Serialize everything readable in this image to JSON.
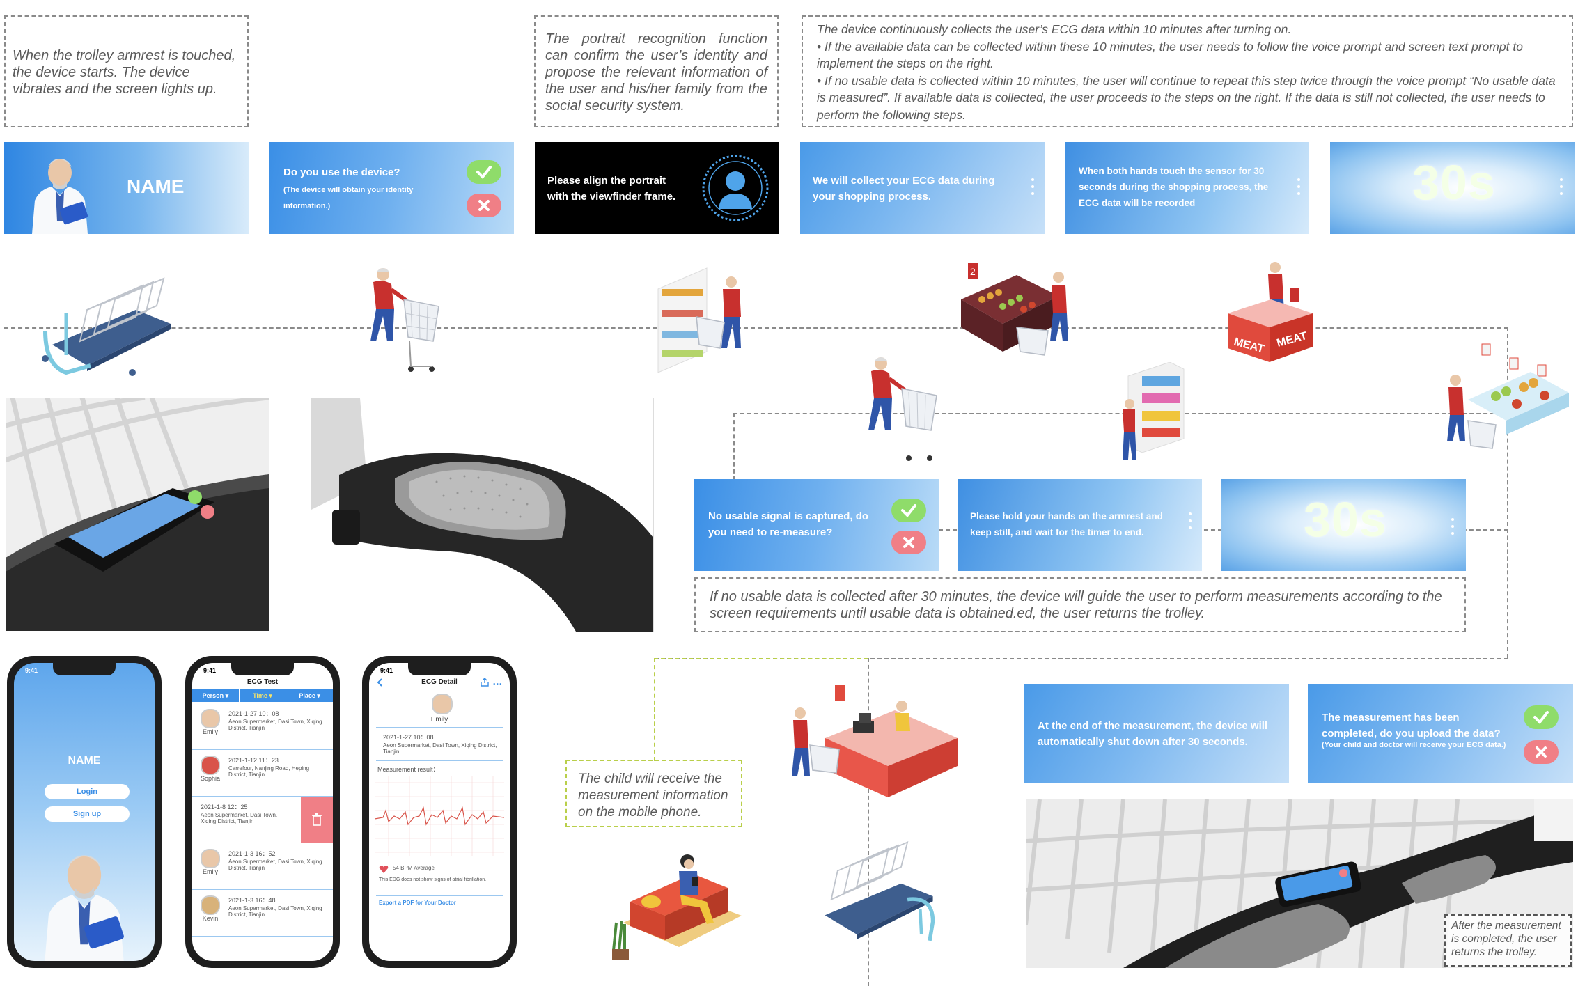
{
  "notes": {
    "start": "When the trolley armrest is touched, the device starts. The device vibrates and the screen lights up.",
    "portrait": "The portrait recognition function can confirm the user’s identity and propose the relevant information of the user and his/her family from the social security system.",
    "ecg_l1": "The device continuously collects the user’s ECG data within 10 minutes after turning on.",
    "ecg_l2": "• If the available data can be collected within these 10 minutes, the user needs to follow the voice prompt and screen text prompt to implement the steps on the right.",
    "ecg_l3": "• If no usable data is collected within 10 minutes, the user will continue to repeat this step twice through the voice prompt “No usable data is measured”. If available data is collected, the user proceeds to the steps on the right. If the data is still not collected, the user needs to perform the following steps.",
    "retry": "If no usable data is collected after 30 minutes, the device will guide the user to perform measurements according to the screen requirements until usable data is obtained.ed, the user returns the trolley.",
    "child": "The child will receive the measurement information on the mobile phone.",
    "return": "After the measurement is completed, the user returns the trolley."
  },
  "screens": {
    "name": "NAME",
    "use_q": "Do you use the device?",
    "use_sub": "(The device will obtain your identity information.)",
    "align": "Please align the portrait with the viewfinder frame.",
    "collect": "We will collect your ECG data during your shopping process.",
    "both_hands": "When both hands touch the sensor for 30 seconds during the shopping process, the ECG data will be recorded",
    "timer": "30s",
    "no_signal": "No usable signal is captured, do you need to re-measure?",
    "hold": "Please hold your hands on the armrest and keep still, and wait for the timer to end.",
    "timer2": "30s",
    "shutdown": "At the end of the measurement, the device will automatically shut down after 30 seconds.",
    "upload": "The measurement has been completed, do you upload the data?",
    "upload_sub": "(Your child and doctor will receive your ECG data.)"
  },
  "scene_labels": {
    "meat1": "MEAT",
    "meat2": "MEAT",
    "sign": "2"
  },
  "phones": {
    "p1": {
      "time": "9:41",
      "name": "NAME",
      "login": "Login",
      "signup": "Sign up"
    },
    "p2": {
      "time": "9:41",
      "title": "ECG Test",
      "filters": [
        "Person ▾",
        "Time ▾",
        "Place ▾"
      ],
      "rows": [
        {
          "name": "Emily",
          "date": "2021-1-27 10：08",
          "place": "Aeon Supermarket, Dasi Town, Xiqing District, Tianjin"
        },
        {
          "name": "Sophia",
          "date": "2021-1-12 11：23",
          "place": "Carrefour, Nanjing Road, Heping District, Tianjin"
        },
        {
          "name": "",
          "date": "2021-1-8 12：25",
          "place": "Aeon Supermarket, Dasi Town, Xiqing District, Tianjin"
        },
        {
          "name": "Emily",
          "date": "2021-1-3 16：52",
          "place": "Aeon Supermarket, Dasi Town, Xiqing District, Tianjin"
        },
        {
          "name": "Kevin",
          "date": "2021-1-3 16：48",
          "place": "Aeon Supermarket, Dasi Town, Xiqing District, Tianjin"
        }
      ]
    },
    "p3": {
      "time": "9:41",
      "title": "ECG Detail",
      "name": "Emily",
      "date": "2021-1-27 10：08",
      "place": "Aeon Supermarket, Dasi Town, Xiqing District, Tianjin",
      "result_label": "Measurement result：",
      "bpm": "54 BPM Average",
      "note": "This EDG does not show signs of atrial fibrillation.",
      "export": "Export a PDF for Your Doctor"
    }
  },
  "colors": {
    "accent": "#4a9ae8",
    "ok": "#8fdc6a",
    "cancel": "#f07f86",
    "dash": "#8a8a8a",
    "child_dash": "#b9cf4a"
  },
  "icons": [
    "check-icon",
    "close-icon",
    "person-silhouette-icon",
    "trash-icon",
    "heart-icon",
    "back-arrow-icon",
    "share-icon",
    "more-icon",
    "calendar-icon",
    "location-icon"
  ]
}
